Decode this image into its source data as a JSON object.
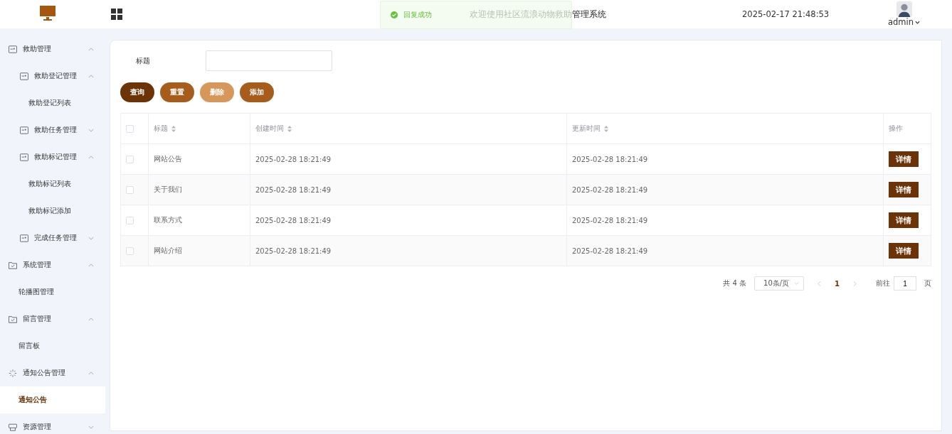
{
  "header": {
    "title": "欢迎使用社区流浪动物救助管理系统",
    "datetime": "2025-02-17 21:48:53",
    "user": "admin"
  },
  "toast": {
    "message": "回复成功"
  },
  "sidebar": {
    "items": [
      {
        "label": "救助管理",
        "kind": "card",
        "expanded": true,
        "children": [
          {
            "label": "救助登记管理",
            "kind": "card",
            "expanded": true,
            "children": [
              {
                "label": "救助登记列表",
                "selected": false
              }
            ]
          },
          {
            "label": "救助任务管理",
            "kind": "card",
            "expanded": false
          },
          {
            "label": "救助标记管理",
            "kind": "card",
            "expanded": true,
            "children": [
              {
                "label": "救助标记列表",
                "selected": false
              },
              {
                "label": "救助标记添加",
                "selected": false
              }
            ]
          },
          {
            "label": "完成任务管理",
            "kind": "card",
            "expanded": false
          }
        ]
      },
      {
        "label": "系统管理",
        "kind": "folder",
        "expanded": true,
        "children": [
          {
            "label": "轮播图管理",
            "selected": false
          }
        ]
      },
      {
        "label": "留言管理",
        "kind": "folder",
        "expanded": true,
        "children": [
          {
            "label": "留言板",
            "selected": false
          }
        ]
      },
      {
        "label": "通知公告管理",
        "kind": "spinner",
        "expanded": true,
        "children": [
          {
            "label": "通知公告",
            "selected": true
          }
        ]
      },
      {
        "label": "资源管理",
        "kind": "box",
        "expanded": false
      }
    ]
  },
  "search": {
    "label": "标题"
  },
  "buttons": [
    {
      "label": "查询",
      "kind": "query"
    },
    {
      "label": "重置",
      "kind": "reset"
    },
    {
      "label": "删除",
      "kind": "delete"
    },
    {
      "label": "添加",
      "kind": "add"
    }
  ],
  "table": {
    "all_checked": false,
    "columns": [
      {
        "label": "标题",
        "sortable": true
      },
      {
        "label": "创建时间",
        "sortable": true
      },
      {
        "label": "更新时间",
        "sortable": true
      },
      {
        "label": "操作",
        "sortable": false
      }
    ],
    "rows": [
      {
        "title": "网站公告",
        "created": "2025-02-28 18:21:49",
        "updated": "2025-02-28 18:21:49",
        "action": "详情",
        "checked": false
      },
      {
        "title": "关于我们",
        "created": "2025-02-28 18:21:49",
        "updated": "2025-02-28 18:21:49",
        "action": "详情",
        "checked": false
      },
      {
        "title": "联系方式",
        "created": "2025-02-28 18:21:49",
        "updated": "2025-02-28 18:21:49",
        "action": "详情",
        "checked": false
      },
      {
        "title": "网站介绍",
        "created": "2025-02-28 18:21:49",
        "updated": "2025-02-28 18:21:49",
        "action": "详情",
        "checked": false
      }
    ]
  },
  "pagination": {
    "total": "共 4 条",
    "page_size": "10条/页",
    "pages": [
      {
        "label": "1",
        "selected": true
      }
    ],
    "goto_label": "前往",
    "goto_value": "1",
    "page_suffix": "页"
  }
}
